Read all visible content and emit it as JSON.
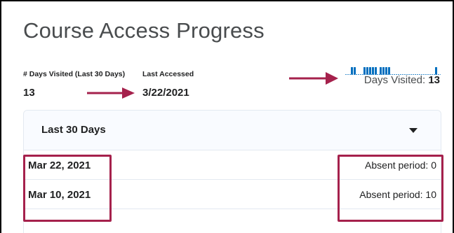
{
  "page_title": "Course Access Progress",
  "stats": {
    "days_visited_label": "# Days Visited (Last 30 Days)",
    "days_visited_value": "13",
    "last_accessed_label": "Last Accessed",
    "last_accessed_value": "3/22/2021"
  },
  "sparkline": {
    "caption_label": "Days Visited:",
    "caption_value": "13",
    "bar_color": "#006fbf",
    "baseline_color": "#006fbf"
  },
  "period_dropdown": {
    "selected_label": "Last 30 Days",
    "icon": "caret-down-icon"
  },
  "rows": [
    {
      "date": "Mar 22, 2021",
      "absent": "Absent period: 0"
    },
    {
      "date": "Mar 10, 2021",
      "absent": "Absent period: 10"
    }
  ],
  "annotation_color": "#a5214c"
}
